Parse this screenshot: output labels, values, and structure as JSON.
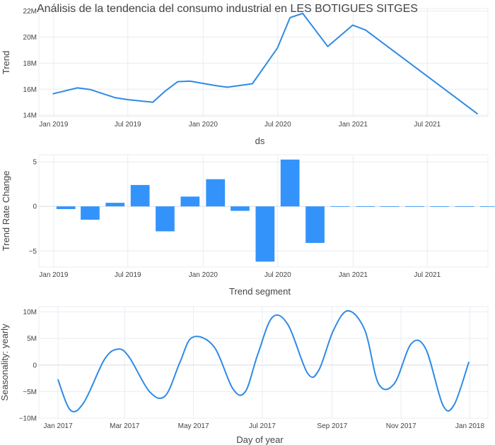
{
  "title": "Análisis de la tendencia del consumo industrial en LES BOTIGUES SITGES",
  "colors": {
    "line": "#2f8ae6",
    "bar": "#3393fb",
    "grid": "#e8ecf2",
    "zero": "#e3e7ee",
    "text": "#444444"
  },
  "chart_data": [
    {
      "type": "line",
      "xlabel": "ds",
      "ylabel": "Trend",
      "x_ticks": [
        "Jan 2019",
        "Jul 2019",
        "Jan 2020",
        "Jul 2020",
        "Jan 2021",
        "Jul 2021"
      ],
      "y_ticks": [
        "14M",
        "16M",
        "18M",
        "20M",
        "22M"
      ],
      "y_tick_values": [
        14,
        16,
        18,
        20,
        22
      ],
      "ylim": [
        13.9,
        22.2
      ],
      "xlim": [
        "2018-11-26",
        "2021-11-26"
      ],
      "series": [
        {
          "x": [
            "2018-12-31",
            "2019-02-28",
            "2019-03-31",
            "2019-05-31",
            "2019-06-30",
            "2019-08-31",
            "2019-09-30",
            "2019-10-31",
            "2019-11-30",
            "2020-01-31",
            "2020-02-29",
            "2020-04-30",
            "2020-06-30",
            "2020-07-31",
            "2020-08-31",
            "2020-10-31",
            "2020-12-31",
            "2021-01-31",
            "2021-10-31"
          ],
          "y": [
            15.65,
            16.1,
            15.98,
            15.35,
            15.2,
            15.0,
            15.85,
            16.58,
            16.62,
            16.28,
            16.15,
            16.42,
            19.15,
            21.5,
            21.82,
            19.28,
            20.92,
            20.55,
            14.12
          ]
        }
      ]
    },
    {
      "type": "bar",
      "xlabel": "Trend segment",
      "ylabel": "Trend Rate Change",
      "x_ticks": [
        "Jan 2019",
        "Jul 2019",
        "Jan 2020",
        "Jul 2020",
        "Jan 2021",
        "Jul 2021"
      ],
      "y_ticks": [
        "−5",
        "0",
        "5"
      ],
      "y_tick_values": [
        -5,
        0,
        5
      ],
      "ylim": [
        -6.8,
        5.8
      ],
      "xlim": [
        "2018-11-26",
        "2021-11-26"
      ],
      "bars": {
        "x": [
          "2019-01-31",
          "2019-03-31",
          "2019-05-31",
          "2019-07-31",
          "2019-09-30",
          "2019-11-30",
          "2020-01-31",
          "2020-03-31",
          "2020-05-31",
          "2020-07-31",
          "2020-09-30",
          "2020-11-30",
          "2021-01-31",
          "2021-03-31",
          "2021-05-31",
          "2021-07-31",
          "2021-09-30",
          "2021-11-30"
        ],
        "y": [
          -0.3,
          -1.5,
          0.4,
          2.4,
          -2.8,
          1.1,
          3.05,
          -0.5,
          -6.2,
          5.25,
          -4.1,
          0,
          0,
          0,
          0,
          0,
          0,
          0
        ]
      }
    },
    {
      "type": "line",
      "xlabel": "Day of year",
      "ylabel": "Seasonality: yearly",
      "x_ticks": [
        "Jan 2017",
        "Mar 2017",
        "May 2017",
        "Jul 2017",
        "Sep 2017",
        "Nov 2017",
        "Jan 2018"
      ],
      "y_ticks": [
        "−10M",
        "−5M",
        "0",
        "5M",
        "10M"
      ],
      "y_tick_values": [
        -10,
        -5,
        0,
        5,
        10
      ],
      "ylim": [
        -10.0,
        11.0
      ],
      "xlim": [
        "2016-12-15",
        "2018-01-17"
      ],
      "series": [
        {
          "x": [
            "2017-01-01",
            "2017-01-12",
            "2017-01-24",
            "2017-02-11",
            "2017-02-23",
            "2017-03-05",
            "2017-03-23",
            "2017-04-06",
            "2017-04-19",
            "2017-04-30",
            "2017-05-19",
            "2017-06-05",
            "2017-06-16",
            "2017-06-27",
            "2017-07-10",
            "2017-07-24",
            "2017-08-10",
            "2017-08-20",
            "2017-09-02",
            "2017-09-15",
            "2017-09-30",
            "2017-10-12",
            "2017-10-26",
            "2017-11-10",
            "2017-11-23",
            "2017-12-08",
            "2017-12-18",
            "2017-12-31"
          ],
          "y": [
            -2.8,
            -8.5,
            -7.0,
            1.0,
            3.0,
            1.5,
            -5.0,
            -5.8,
            0.5,
            5.2,
            3.5,
            -4.5,
            -5.0,
            2.0,
            9.0,
            7.5,
            -1.5,
            -1.0,
            6.5,
            10.2,
            6.5,
            -3.5,
            -3.5,
            4.0,
            3.0,
            -7.5,
            -7.5,
            0.5
          ]
        }
      ]
    }
  ]
}
